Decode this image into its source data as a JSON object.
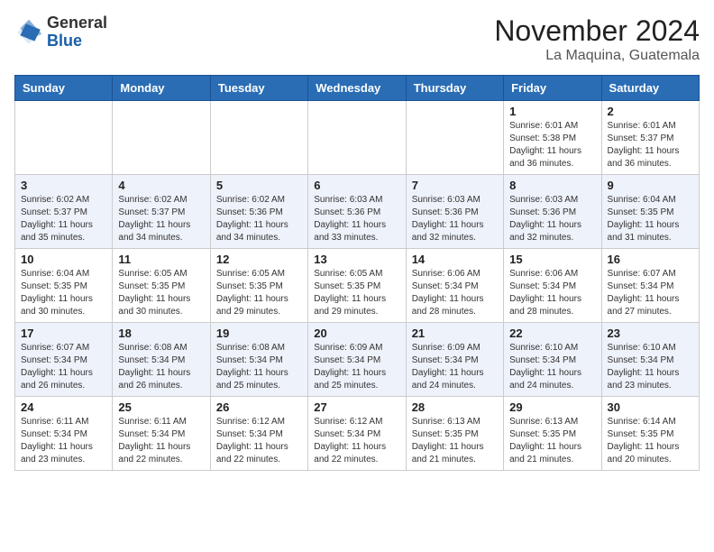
{
  "header": {
    "logo_line1": "General",
    "logo_line2": "Blue",
    "month": "November 2024",
    "location": "La Maquina, Guatemala"
  },
  "weekdays": [
    "Sunday",
    "Monday",
    "Tuesday",
    "Wednesday",
    "Thursday",
    "Friday",
    "Saturday"
  ],
  "weeks": [
    [
      {
        "day": "",
        "info": ""
      },
      {
        "day": "",
        "info": ""
      },
      {
        "day": "",
        "info": ""
      },
      {
        "day": "",
        "info": ""
      },
      {
        "day": "",
        "info": ""
      },
      {
        "day": "1",
        "info": "Sunrise: 6:01 AM\nSunset: 5:38 PM\nDaylight: 11 hours and 36 minutes."
      },
      {
        "day": "2",
        "info": "Sunrise: 6:01 AM\nSunset: 5:37 PM\nDaylight: 11 hours and 36 minutes."
      }
    ],
    [
      {
        "day": "3",
        "info": "Sunrise: 6:02 AM\nSunset: 5:37 PM\nDaylight: 11 hours and 35 minutes."
      },
      {
        "day": "4",
        "info": "Sunrise: 6:02 AM\nSunset: 5:37 PM\nDaylight: 11 hours and 34 minutes."
      },
      {
        "day": "5",
        "info": "Sunrise: 6:02 AM\nSunset: 5:36 PM\nDaylight: 11 hours and 34 minutes."
      },
      {
        "day": "6",
        "info": "Sunrise: 6:03 AM\nSunset: 5:36 PM\nDaylight: 11 hours and 33 minutes."
      },
      {
        "day": "7",
        "info": "Sunrise: 6:03 AM\nSunset: 5:36 PM\nDaylight: 11 hours and 32 minutes."
      },
      {
        "day": "8",
        "info": "Sunrise: 6:03 AM\nSunset: 5:36 PM\nDaylight: 11 hours and 32 minutes."
      },
      {
        "day": "9",
        "info": "Sunrise: 6:04 AM\nSunset: 5:35 PM\nDaylight: 11 hours and 31 minutes."
      }
    ],
    [
      {
        "day": "10",
        "info": "Sunrise: 6:04 AM\nSunset: 5:35 PM\nDaylight: 11 hours and 30 minutes."
      },
      {
        "day": "11",
        "info": "Sunrise: 6:05 AM\nSunset: 5:35 PM\nDaylight: 11 hours and 30 minutes."
      },
      {
        "day": "12",
        "info": "Sunrise: 6:05 AM\nSunset: 5:35 PM\nDaylight: 11 hours and 29 minutes."
      },
      {
        "day": "13",
        "info": "Sunrise: 6:05 AM\nSunset: 5:35 PM\nDaylight: 11 hours and 29 minutes."
      },
      {
        "day": "14",
        "info": "Sunrise: 6:06 AM\nSunset: 5:34 PM\nDaylight: 11 hours and 28 minutes."
      },
      {
        "day": "15",
        "info": "Sunrise: 6:06 AM\nSunset: 5:34 PM\nDaylight: 11 hours and 28 minutes."
      },
      {
        "day": "16",
        "info": "Sunrise: 6:07 AM\nSunset: 5:34 PM\nDaylight: 11 hours and 27 minutes."
      }
    ],
    [
      {
        "day": "17",
        "info": "Sunrise: 6:07 AM\nSunset: 5:34 PM\nDaylight: 11 hours and 26 minutes."
      },
      {
        "day": "18",
        "info": "Sunrise: 6:08 AM\nSunset: 5:34 PM\nDaylight: 11 hours and 26 minutes."
      },
      {
        "day": "19",
        "info": "Sunrise: 6:08 AM\nSunset: 5:34 PM\nDaylight: 11 hours and 25 minutes."
      },
      {
        "day": "20",
        "info": "Sunrise: 6:09 AM\nSunset: 5:34 PM\nDaylight: 11 hours and 25 minutes."
      },
      {
        "day": "21",
        "info": "Sunrise: 6:09 AM\nSunset: 5:34 PM\nDaylight: 11 hours and 24 minutes."
      },
      {
        "day": "22",
        "info": "Sunrise: 6:10 AM\nSunset: 5:34 PM\nDaylight: 11 hours and 24 minutes."
      },
      {
        "day": "23",
        "info": "Sunrise: 6:10 AM\nSunset: 5:34 PM\nDaylight: 11 hours and 23 minutes."
      }
    ],
    [
      {
        "day": "24",
        "info": "Sunrise: 6:11 AM\nSunset: 5:34 PM\nDaylight: 11 hours and 23 minutes."
      },
      {
        "day": "25",
        "info": "Sunrise: 6:11 AM\nSunset: 5:34 PM\nDaylight: 11 hours and 22 minutes."
      },
      {
        "day": "26",
        "info": "Sunrise: 6:12 AM\nSunset: 5:34 PM\nDaylight: 11 hours and 22 minutes."
      },
      {
        "day": "27",
        "info": "Sunrise: 6:12 AM\nSunset: 5:34 PM\nDaylight: 11 hours and 22 minutes."
      },
      {
        "day": "28",
        "info": "Sunrise: 6:13 AM\nSunset: 5:35 PM\nDaylight: 11 hours and 21 minutes."
      },
      {
        "day": "29",
        "info": "Sunrise: 6:13 AM\nSunset: 5:35 PM\nDaylight: 11 hours and 21 minutes."
      },
      {
        "day": "30",
        "info": "Sunrise: 6:14 AM\nSunset: 5:35 PM\nDaylight: 11 hours and 20 minutes."
      }
    ]
  ]
}
